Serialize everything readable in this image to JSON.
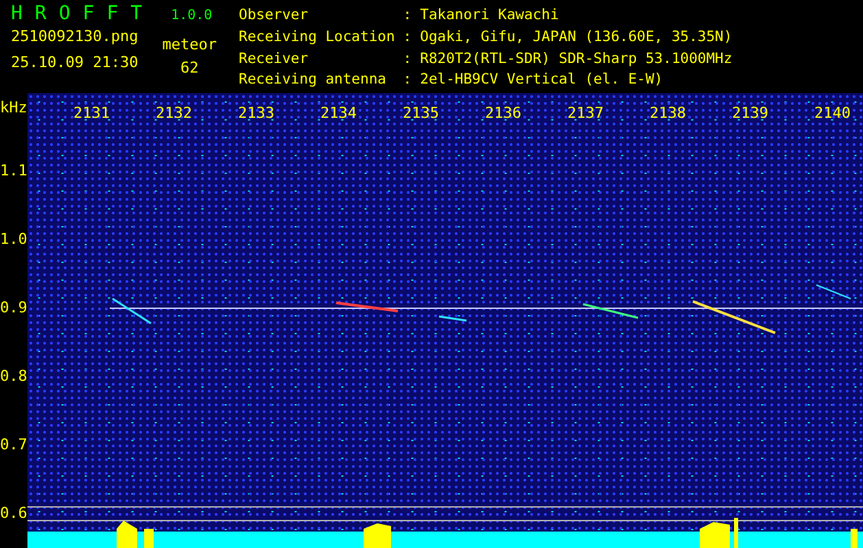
{
  "header": {
    "app_name": "HROFFT",
    "version": "1.0.0",
    "filename": "2510092130.png",
    "datetime": "25.10.09 21:30",
    "count_label": "meteor",
    "count": "62",
    "info": [
      {
        "label": "Observer",
        "separator": ":",
        "value": "Takanori Kawachi"
      },
      {
        "label": "Receiving Location",
        "separator": ":",
        "value": "Ogaki, Gifu, JAPAN (136.60E, 35.35N)"
      },
      {
        "label": "Receiver",
        "separator": ":",
        "value": "R820T2(RTL-SDR) SDR-Sharp 53.1000MHz"
      },
      {
        "label": "Receiving antenna",
        "separator": ":",
        "value": "2el-HB9CV Vertical (el. E-W)"
      }
    ]
  },
  "plot": {
    "y_unit": "kHz",
    "y_ticks": [
      "1.1",
      "1.0",
      "0.9",
      "0.8",
      "0.7",
      "0.6"
    ],
    "x_ticks": [
      "2131",
      "2132",
      "2133",
      "2134",
      "2135",
      "2136",
      "2137",
      "2138",
      "2139",
      "2140"
    ]
  }
}
